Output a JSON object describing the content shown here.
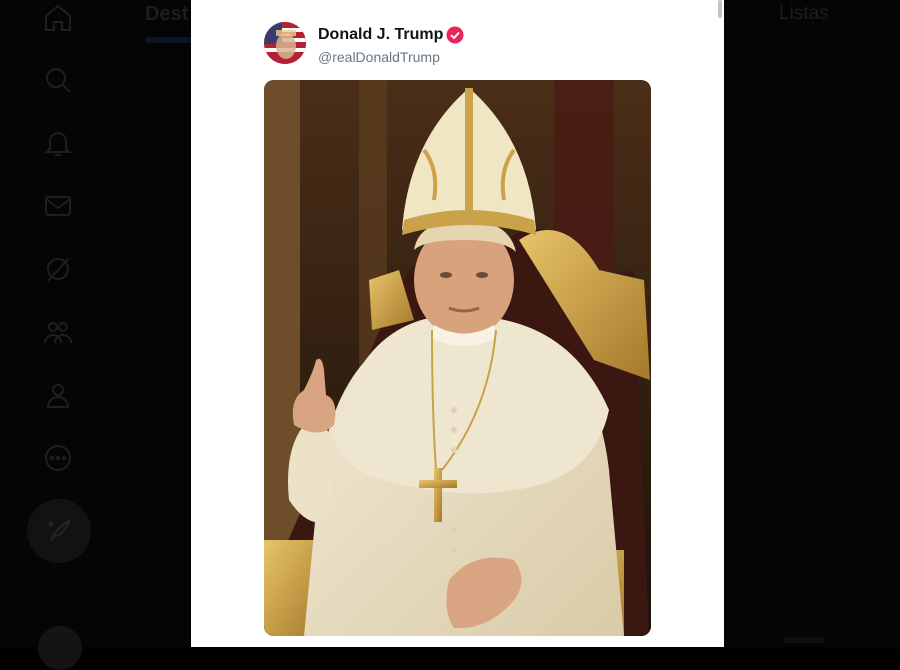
{
  "background_ui": {
    "header_left_text": "Dest",
    "header_right_text": "Listas",
    "nav_icons": [
      "home-icon",
      "search-icon",
      "bell-icon",
      "mail-icon",
      "grok-icon",
      "communities-icon",
      "profile-icon",
      "more-icon"
    ],
    "compose_icon": "feather-icon"
  },
  "post": {
    "author_name": "Donald J. Trump",
    "author_handle": "@realDonaldTrump",
    "verified": true,
    "verified_color": "#e8245b",
    "media_description_icon": "pope-portrait-image"
  },
  "colors": {
    "card_bg": "#ffffff",
    "page_bg": "#000000",
    "name_color": "#0f1419",
    "handle_color": "#657786"
  }
}
